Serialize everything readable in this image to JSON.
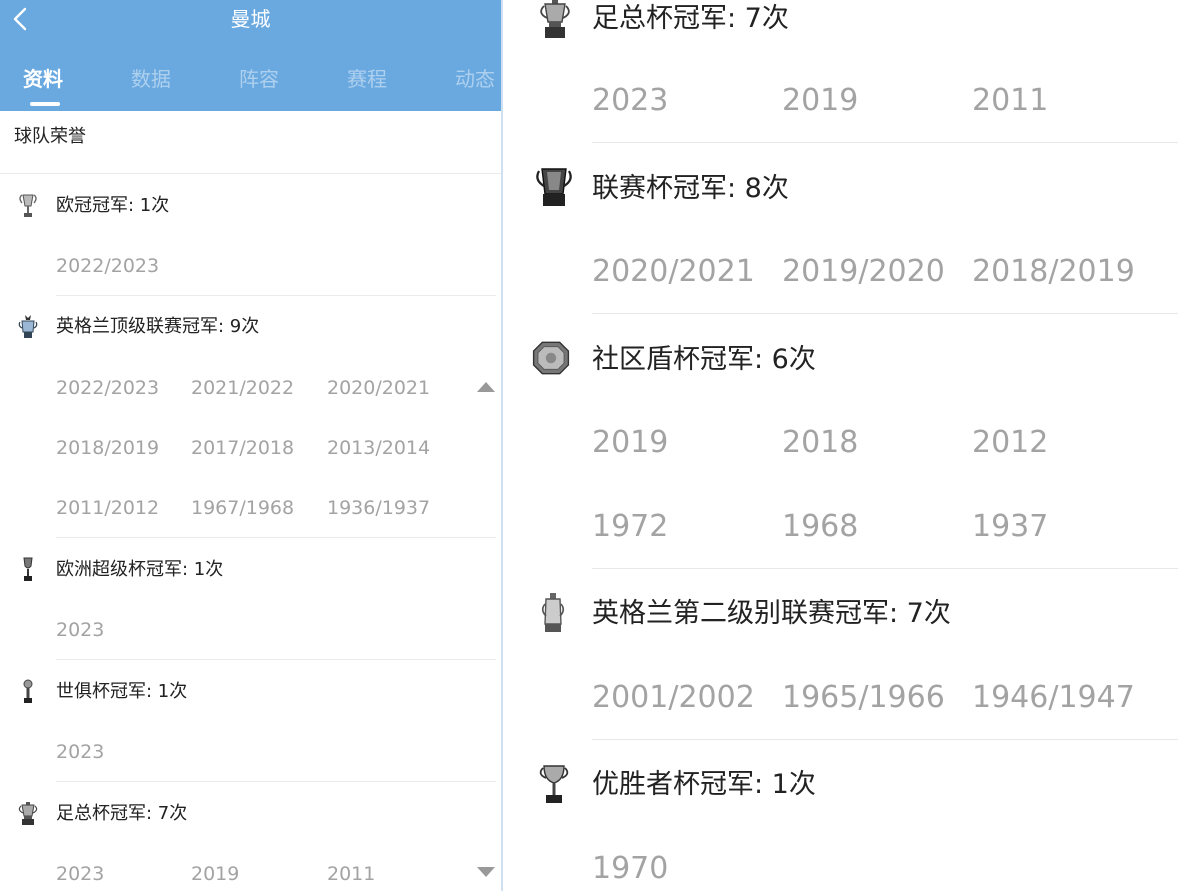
{
  "header": {
    "team_name": "曼城",
    "back_icon": "chevron-left-icon",
    "background": "#6aa9e0"
  },
  "tabs": [
    {
      "label": "资料",
      "active": true
    },
    {
      "label": "数据",
      "active": false
    },
    {
      "label": "阵容",
      "active": false
    },
    {
      "label": "赛程",
      "active": false
    },
    {
      "label": "动态",
      "active": false
    }
  ],
  "section_title": "球队荣誉",
  "left_honors": [
    {
      "icon": "champions-league-trophy-icon",
      "title": "欧冠冠军: 1次",
      "years": [
        "2022/2023"
      ]
    },
    {
      "icon": "premier-league-trophy-icon",
      "title": "英格兰顶级联赛冠军: 9次",
      "years": [
        "2022/2023",
        "2021/2022",
        "2020/2021",
        "2018/2019",
        "2017/2018",
        "2013/2014",
        "2011/2012",
        "1967/1968",
        "1936/1937"
      ]
    },
    {
      "icon": "super-cup-trophy-icon",
      "title": "欧洲超级杯冠军: 1次",
      "years": [
        "2023"
      ]
    },
    {
      "icon": "club-world-cup-trophy-icon",
      "title": "世俱杯冠军: 1次",
      "years": [
        "2023"
      ]
    },
    {
      "icon": "fa-cup-trophy-icon",
      "title": "足总杯冠军: 7次",
      "years": [
        "2023",
        "2019",
        "2011"
      ]
    }
  ],
  "right_honors": [
    {
      "icon": "fa-cup-trophy-icon",
      "title": "足总杯冠军: 7次",
      "years": [
        "2023",
        "2019",
        "2011"
      ]
    },
    {
      "icon": "league-cup-trophy-icon",
      "title": "联赛杯冠军: 8次",
      "years": [
        "2020/2021",
        "2019/2020",
        "2018/2019"
      ]
    },
    {
      "icon": "community-shield-icon",
      "title": "社区盾杯冠军: 6次",
      "years": [
        "2019",
        "2018",
        "2012",
        "1972",
        "1968",
        "1937"
      ]
    },
    {
      "icon": "second-tier-trophy-icon",
      "title": "英格兰第二级别联赛冠军: 7次",
      "years": [
        "2001/2002",
        "1965/1966",
        "1946/1947"
      ]
    },
    {
      "icon": "cup-winners-cup-trophy-icon",
      "title": "优胜者杯冠军: 1次",
      "years": [
        "1970"
      ]
    }
  ]
}
